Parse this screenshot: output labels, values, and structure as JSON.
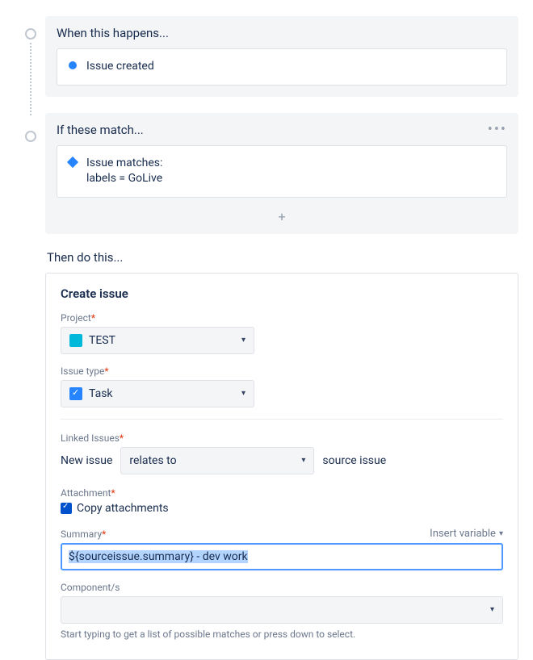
{
  "trigger": {
    "header": "When this happens...",
    "label": "Issue created"
  },
  "condition": {
    "header": "If these match...",
    "label_line1": "Issue matches:",
    "label_line2": "labels = GoLive"
  },
  "action": {
    "header": "Then do this...",
    "form_title": "Create issue",
    "project": {
      "label": "Project",
      "value": "TEST"
    },
    "issue_type": {
      "label": "Issue type",
      "value": "Task"
    },
    "linked_issues": {
      "label": "Linked Issues",
      "new_issue_label": "New issue",
      "relation": "relates to",
      "source_label": "source issue"
    },
    "attachment": {
      "label": "Attachment",
      "checkbox_label": "Copy attachments"
    },
    "summary": {
      "label": "Summary",
      "insert_variable": "Insert variable",
      "value": "${sourceissue.summary} - dev work"
    },
    "components": {
      "label": "Component/s",
      "help": "Start typing to get a list of possible matches or press down to select."
    }
  }
}
